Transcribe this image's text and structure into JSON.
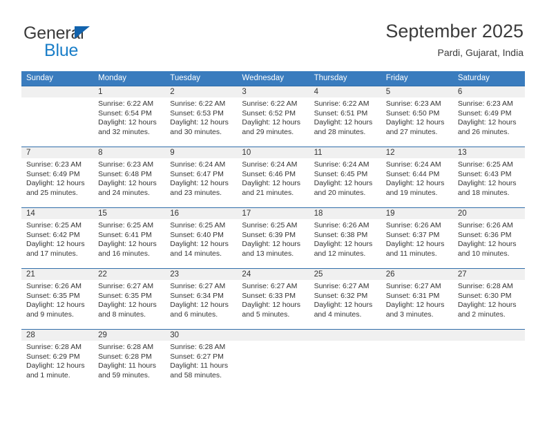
{
  "brand": {
    "line1": "General",
    "line2": "Blue",
    "triangle_icon": "triangle-icon",
    "color_dark": "#3b3b3b",
    "color_blue": "#1a7ec8"
  },
  "header": {
    "title": "September 2025",
    "subtitle": "Pardi, Gujarat, India"
  },
  "theme": {
    "header_row_bg": "#3a7cbe",
    "row_border": "#2f6ca8",
    "day_strip_bg": "#f0f0f0",
    "text": "#333333"
  },
  "weekdays": [
    "Sunday",
    "Monday",
    "Tuesday",
    "Wednesday",
    "Thursday",
    "Friday",
    "Saturday"
  ],
  "labels": {
    "sunrise_prefix": "Sunrise:",
    "sunset_prefix": "Sunset:",
    "daylight_prefix": "Daylight:"
  },
  "weeks": [
    [
      {
        "day": "",
        "sunrise": "",
        "sunset": "",
        "daylight_a": "",
        "daylight_b": ""
      },
      {
        "day": "1",
        "sunrise": "Sunrise: 6:22 AM",
        "sunset": "Sunset: 6:54 PM",
        "daylight_a": "Daylight: 12 hours",
        "daylight_b": "and 32 minutes."
      },
      {
        "day": "2",
        "sunrise": "Sunrise: 6:22 AM",
        "sunset": "Sunset: 6:53 PM",
        "daylight_a": "Daylight: 12 hours",
        "daylight_b": "and 30 minutes."
      },
      {
        "day": "3",
        "sunrise": "Sunrise: 6:22 AM",
        "sunset": "Sunset: 6:52 PM",
        "daylight_a": "Daylight: 12 hours",
        "daylight_b": "and 29 minutes."
      },
      {
        "day": "4",
        "sunrise": "Sunrise: 6:22 AM",
        "sunset": "Sunset: 6:51 PM",
        "daylight_a": "Daylight: 12 hours",
        "daylight_b": "and 28 minutes."
      },
      {
        "day": "5",
        "sunrise": "Sunrise: 6:23 AM",
        "sunset": "Sunset: 6:50 PM",
        "daylight_a": "Daylight: 12 hours",
        "daylight_b": "and 27 minutes."
      },
      {
        "day": "6",
        "sunrise": "Sunrise: 6:23 AM",
        "sunset": "Sunset: 6:49 PM",
        "daylight_a": "Daylight: 12 hours",
        "daylight_b": "and 26 minutes."
      }
    ],
    [
      {
        "day": "7",
        "sunrise": "Sunrise: 6:23 AM",
        "sunset": "Sunset: 6:49 PM",
        "daylight_a": "Daylight: 12 hours",
        "daylight_b": "and 25 minutes."
      },
      {
        "day": "8",
        "sunrise": "Sunrise: 6:23 AM",
        "sunset": "Sunset: 6:48 PM",
        "daylight_a": "Daylight: 12 hours",
        "daylight_b": "and 24 minutes."
      },
      {
        "day": "9",
        "sunrise": "Sunrise: 6:24 AM",
        "sunset": "Sunset: 6:47 PM",
        "daylight_a": "Daylight: 12 hours",
        "daylight_b": "and 23 minutes."
      },
      {
        "day": "10",
        "sunrise": "Sunrise: 6:24 AM",
        "sunset": "Sunset: 6:46 PM",
        "daylight_a": "Daylight: 12 hours",
        "daylight_b": "and 21 minutes."
      },
      {
        "day": "11",
        "sunrise": "Sunrise: 6:24 AM",
        "sunset": "Sunset: 6:45 PM",
        "daylight_a": "Daylight: 12 hours",
        "daylight_b": "and 20 minutes."
      },
      {
        "day": "12",
        "sunrise": "Sunrise: 6:24 AM",
        "sunset": "Sunset: 6:44 PM",
        "daylight_a": "Daylight: 12 hours",
        "daylight_b": "and 19 minutes."
      },
      {
        "day": "13",
        "sunrise": "Sunrise: 6:25 AM",
        "sunset": "Sunset: 6:43 PM",
        "daylight_a": "Daylight: 12 hours",
        "daylight_b": "and 18 minutes."
      }
    ],
    [
      {
        "day": "14",
        "sunrise": "Sunrise: 6:25 AM",
        "sunset": "Sunset: 6:42 PM",
        "daylight_a": "Daylight: 12 hours",
        "daylight_b": "and 17 minutes."
      },
      {
        "day": "15",
        "sunrise": "Sunrise: 6:25 AM",
        "sunset": "Sunset: 6:41 PM",
        "daylight_a": "Daylight: 12 hours",
        "daylight_b": "and 16 minutes."
      },
      {
        "day": "16",
        "sunrise": "Sunrise: 6:25 AM",
        "sunset": "Sunset: 6:40 PM",
        "daylight_a": "Daylight: 12 hours",
        "daylight_b": "and 14 minutes."
      },
      {
        "day": "17",
        "sunrise": "Sunrise: 6:25 AM",
        "sunset": "Sunset: 6:39 PM",
        "daylight_a": "Daylight: 12 hours",
        "daylight_b": "and 13 minutes."
      },
      {
        "day": "18",
        "sunrise": "Sunrise: 6:26 AM",
        "sunset": "Sunset: 6:38 PM",
        "daylight_a": "Daylight: 12 hours",
        "daylight_b": "and 12 minutes."
      },
      {
        "day": "19",
        "sunrise": "Sunrise: 6:26 AM",
        "sunset": "Sunset: 6:37 PM",
        "daylight_a": "Daylight: 12 hours",
        "daylight_b": "and 11 minutes."
      },
      {
        "day": "20",
        "sunrise": "Sunrise: 6:26 AM",
        "sunset": "Sunset: 6:36 PM",
        "daylight_a": "Daylight: 12 hours",
        "daylight_b": "and 10 minutes."
      }
    ],
    [
      {
        "day": "21",
        "sunrise": "Sunrise: 6:26 AM",
        "sunset": "Sunset: 6:35 PM",
        "daylight_a": "Daylight: 12 hours",
        "daylight_b": "and 9 minutes."
      },
      {
        "day": "22",
        "sunrise": "Sunrise: 6:27 AM",
        "sunset": "Sunset: 6:35 PM",
        "daylight_a": "Daylight: 12 hours",
        "daylight_b": "and 8 minutes."
      },
      {
        "day": "23",
        "sunrise": "Sunrise: 6:27 AM",
        "sunset": "Sunset: 6:34 PM",
        "daylight_a": "Daylight: 12 hours",
        "daylight_b": "and 6 minutes."
      },
      {
        "day": "24",
        "sunrise": "Sunrise: 6:27 AM",
        "sunset": "Sunset: 6:33 PM",
        "daylight_a": "Daylight: 12 hours",
        "daylight_b": "and 5 minutes."
      },
      {
        "day": "25",
        "sunrise": "Sunrise: 6:27 AM",
        "sunset": "Sunset: 6:32 PM",
        "daylight_a": "Daylight: 12 hours",
        "daylight_b": "and 4 minutes."
      },
      {
        "day": "26",
        "sunrise": "Sunrise: 6:27 AM",
        "sunset": "Sunset: 6:31 PM",
        "daylight_a": "Daylight: 12 hours",
        "daylight_b": "and 3 minutes."
      },
      {
        "day": "27",
        "sunrise": "Sunrise: 6:28 AM",
        "sunset": "Sunset: 6:30 PM",
        "daylight_a": "Daylight: 12 hours",
        "daylight_b": "and 2 minutes."
      }
    ],
    [
      {
        "day": "28",
        "sunrise": "Sunrise: 6:28 AM",
        "sunset": "Sunset: 6:29 PM",
        "daylight_a": "Daylight: 12 hours",
        "daylight_b": "and 1 minute."
      },
      {
        "day": "29",
        "sunrise": "Sunrise: 6:28 AM",
        "sunset": "Sunset: 6:28 PM",
        "daylight_a": "Daylight: 11 hours",
        "daylight_b": "and 59 minutes."
      },
      {
        "day": "30",
        "sunrise": "Sunrise: 6:28 AM",
        "sunset": "Sunset: 6:27 PM",
        "daylight_a": "Daylight: 11 hours",
        "daylight_b": "and 58 minutes."
      },
      {
        "day": "",
        "sunrise": "",
        "sunset": "",
        "daylight_a": "",
        "daylight_b": ""
      },
      {
        "day": "",
        "sunrise": "",
        "sunset": "",
        "daylight_a": "",
        "daylight_b": ""
      },
      {
        "day": "",
        "sunrise": "",
        "sunset": "",
        "daylight_a": "",
        "daylight_b": ""
      },
      {
        "day": "",
        "sunrise": "",
        "sunset": "",
        "daylight_a": "",
        "daylight_b": ""
      }
    ]
  ]
}
